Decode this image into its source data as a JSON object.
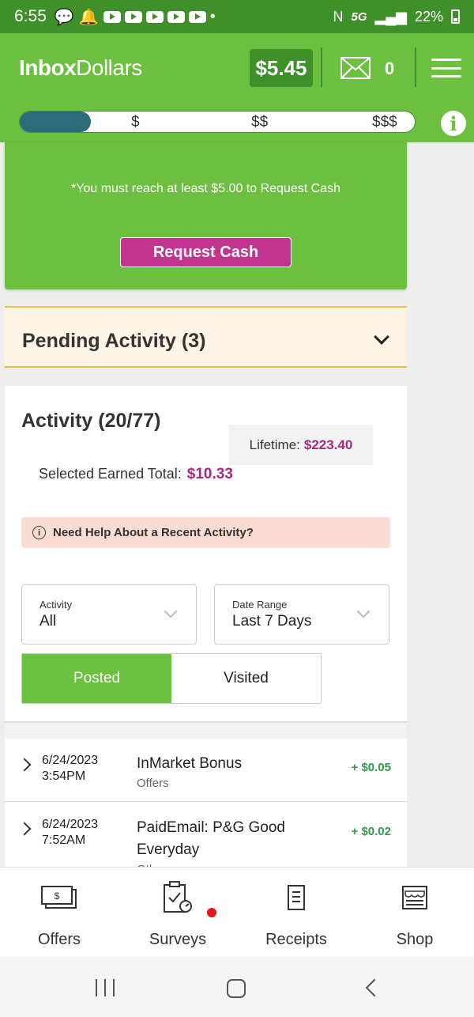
{
  "status_bar": {
    "time": "6:55",
    "network": "5G",
    "battery": "22%"
  },
  "header": {
    "logo_bold": "Inbox",
    "logo_regular": "Dollars",
    "balance": "$5.45",
    "mail_count": "0",
    "progress": {
      "fraction": 0.18,
      "tiers": [
        "$",
        "$$",
        "$$$"
      ]
    }
  },
  "cash_card": {
    "note": "*You must reach at least $5.00 to Request Cash",
    "button_label": "Request Cash"
  },
  "pending": {
    "title": "Pending Activity (3)"
  },
  "activity": {
    "title": "Activity (20/77)",
    "lifetime_label": "Lifetime:",
    "lifetime_value": "$223.40",
    "selected_label": "Selected Earned Total:",
    "selected_value": "$10.33",
    "help_text": "Need Help About a Recent Activity?",
    "filters": [
      {
        "label": "Activity",
        "value": "All"
      },
      {
        "label": "Date Range",
        "value": "Last 7 Days"
      }
    ],
    "toggle": {
      "active": "Posted",
      "inactive": "Visited"
    },
    "rows": [
      {
        "date": "6/24/2023",
        "time": "3:54PM",
        "title": "InMarket Bonus",
        "category": "Offers",
        "amount": "+ $0.05"
      },
      {
        "date": "6/24/2023",
        "time": "7:52AM",
        "title": "PaidEmail: P&G Good Everyday",
        "category": "Other",
        "amount": "+ $0.02"
      }
    ]
  },
  "bottom_nav": {
    "items": [
      {
        "label": "Offers",
        "icon": "money-icon"
      },
      {
        "label": "Surveys",
        "icon": "clipboard-icon"
      },
      {
        "label": "Receipts",
        "icon": "receipt-icon"
      },
      {
        "label": "Shop",
        "icon": "shop-icon"
      }
    ]
  },
  "colors": {
    "brand_green": "#6dbf40",
    "dark_green": "#3f8f2a",
    "accent_magenta": "#c2358f",
    "amount_green": "#2e9a4a"
  }
}
